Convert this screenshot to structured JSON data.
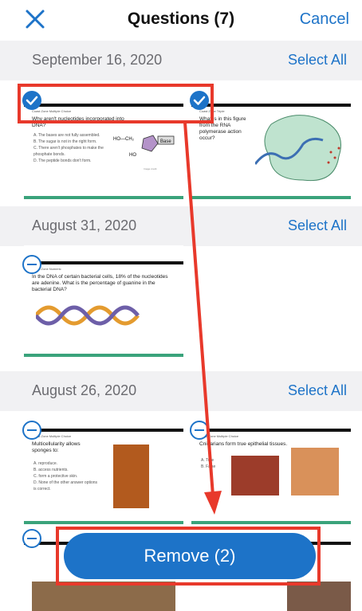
{
  "header": {
    "title": "Questions (7)",
    "cancel_label": "Cancel"
  },
  "sections": [
    {
      "date": "September 16, 2020",
      "select_all": "Select All"
    },
    {
      "date": "August 31, 2020",
      "select_all": "Select All"
    },
    {
      "date": "August 26, 2020",
      "select_all": "Select All"
    }
  ],
  "remove_label": "Remove (2)",
  "colors": {
    "accent": "#1d73c8",
    "annotation": "#e8392b",
    "slide_rule": "#3aa37b"
  }
}
